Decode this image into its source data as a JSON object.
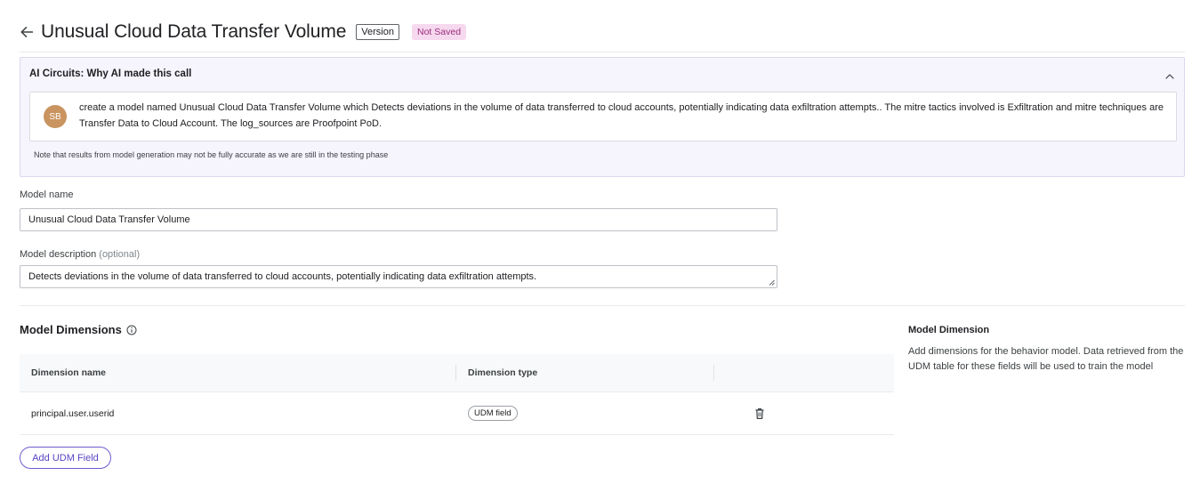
{
  "header": {
    "title": "Unusual Cloud Data Transfer Volume",
    "version_label": "Version",
    "status_badge": "Not Saved"
  },
  "ai_panel": {
    "title": "AI Circuits: Why AI made this call",
    "avatar_initials": "SB",
    "prompt": "create a model named Unusual Cloud Data Transfer Volume which Detects deviations in the volume of data transferred to cloud accounts, potentially indicating data exfiltration attempts.. The mitre tactics involved is Exfiltration and mitre techniques are Transfer Data to Cloud Account. The log_sources are Proofpoint PoD.",
    "note": "Note that results from model generation may not be fully accurate as we are still in the testing phase"
  },
  "form": {
    "name_label": "Model name",
    "name_value": "Unusual Cloud Data Transfer Volume",
    "description_label": "Model description",
    "description_optional": "(optional)",
    "description_value": "Detects deviations in the volume of data transferred to cloud accounts, potentially indicating data exfiltration attempts."
  },
  "dimensions": {
    "title": "Model Dimensions",
    "columns": [
      "Dimension name",
      "Dimension type"
    ],
    "rows": [
      {
        "name": "principal.user.userid",
        "type": "UDM field"
      }
    ],
    "add_button": "Add UDM Field"
  },
  "help": {
    "title": "Model Dimension",
    "text": "Add dimensions for the behavior model. Data retrieved from the UDM table for these fields will be used to train the model"
  },
  "icons": [
    "arrow-back-icon",
    "chevron-up-icon",
    "info-icon",
    "trash-icon"
  ],
  "colors": {
    "accent": "#5b45c4",
    "status_badge_bg": "#f6d9ee",
    "status_badge_text": "#9b2c7e",
    "ai_panel_bg": "#f6f4fc",
    "avatar_bg": "#c9945f"
  }
}
